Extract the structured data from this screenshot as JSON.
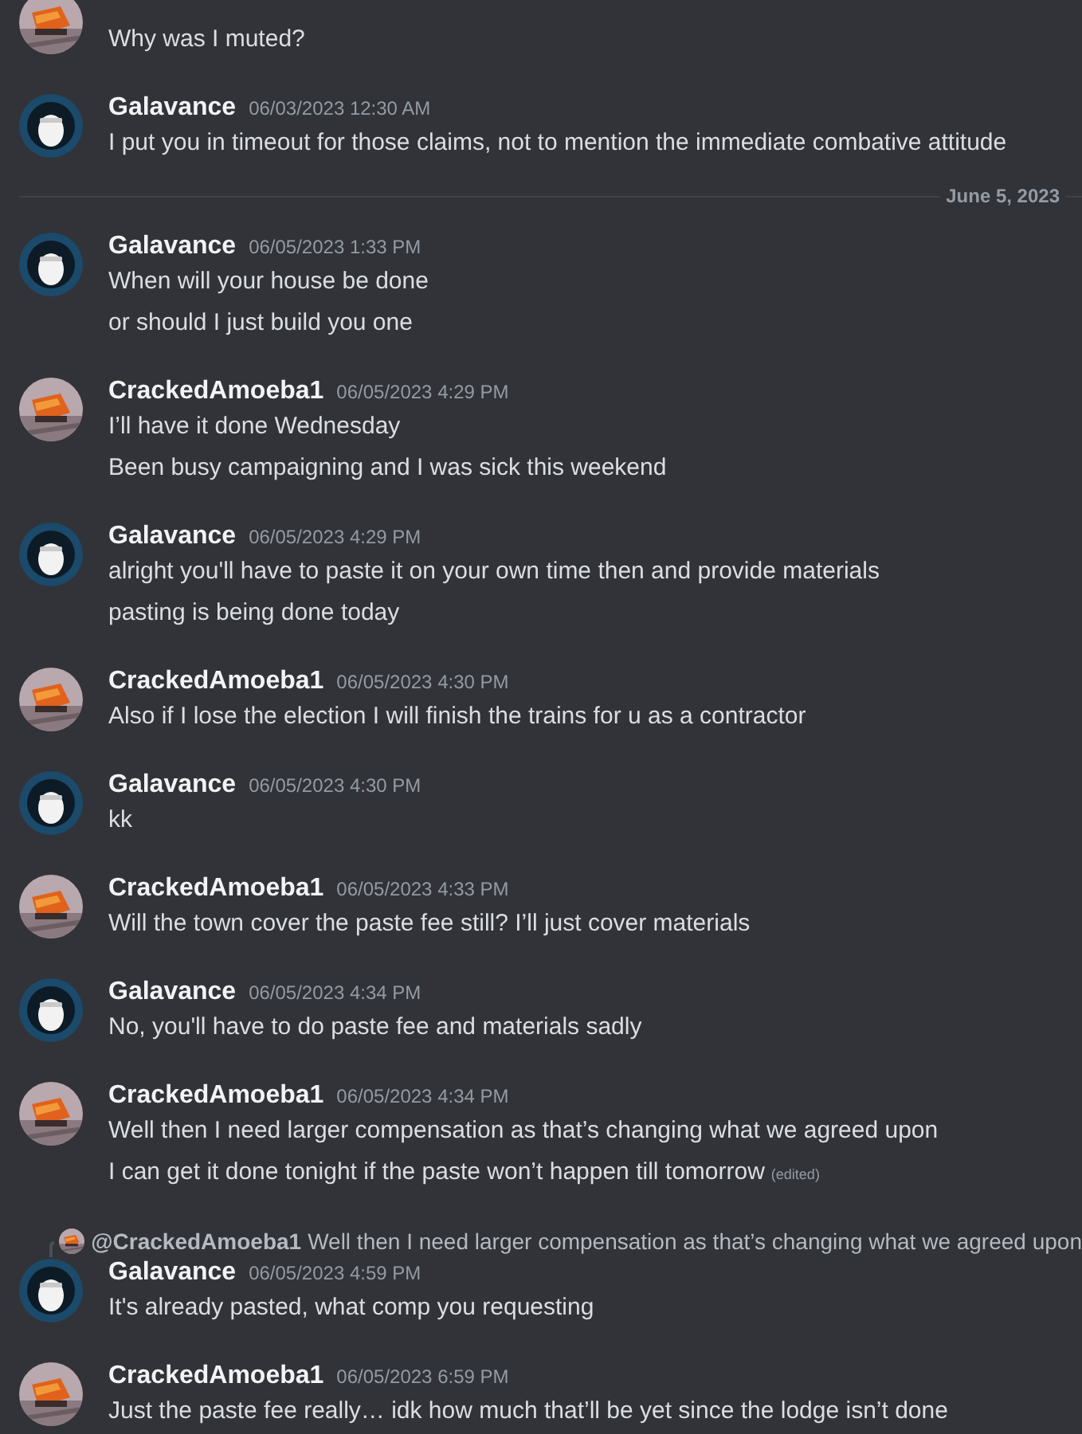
{
  "feed": [
    {
      "kind": "message",
      "avatar": {
        "kind": "train"
      },
      "lines": [
        {
          "text": "Why was I muted?"
        }
      ]
    },
    {
      "kind": "message",
      "author": "Galavance",
      "timestamp": "06/03/2023 12:30 AM",
      "avatar": {
        "kind": "figure"
      },
      "lines": [
        {
          "text": "I put you in timeout for those claims, not to mention the immediate combative attitude"
        }
      ]
    },
    {
      "kind": "divider",
      "label": "June 5, 2023"
    },
    {
      "kind": "message",
      "author": "Galavance",
      "timestamp": "06/05/2023 1:33 PM",
      "avatar": {
        "kind": "figure"
      },
      "lines": [
        {
          "text": "When will your house be done"
        },
        {
          "text": "or should I just build you one"
        }
      ]
    },
    {
      "kind": "message",
      "author": "CrackedAmoeba1",
      "timestamp": "06/05/2023 4:29 PM",
      "avatar": {
        "kind": "train"
      },
      "lines": [
        {
          "text": "I’ll have it done Wednesday"
        },
        {
          "text": "Been busy campaigning and I was sick this weekend"
        }
      ]
    },
    {
      "kind": "message",
      "author": "Galavance",
      "timestamp": "06/05/2023 4:29 PM",
      "avatar": {
        "kind": "figure"
      },
      "lines": [
        {
          "text": "alright you'll have to paste it on your own time then and provide materials"
        },
        {
          "text": "pasting is being done today"
        }
      ]
    },
    {
      "kind": "message",
      "author": "CrackedAmoeba1",
      "timestamp": "06/05/2023 4:30 PM",
      "avatar": {
        "kind": "train"
      },
      "lines": [
        {
          "text": "Also if I lose the election I will finish the trains for u as a contractor"
        }
      ]
    },
    {
      "kind": "message",
      "author": "Galavance",
      "timestamp": "06/05/2023 4:30 PM",
      "avatar": {
        "kind": "figure"
      },
      "lines": [
        {
          "text": "kk"
        }
      ]
    },
    {
      "kind": "message",
      "author": "CrackedAmoeba1",
      "timestamp": "06/05/2023 4:33 PM",
      "avatar": {
        "kind": "train"
      },
      "lines": [
        {
          "text": "Will the town cover the paste fee still? I’ll just cover materials"
        }
      ]
    },
    {
      "kind": "message",
      "author": "Galavance",
      "timestamp": "06/05/2023 4:34 PM",
      "avatar": {
        "kind": "figure"
      },
      "lines": [
        {
          "text": "No, you'll have to do paste fee and materials sadly"
        }
      ]
    },
    {
      "kind": "message",
      "author": "CrackedAmoeba1",
      "timestamp": "06/05/2023 4:34 PM",
      "avatar": {
        "kind": "train"
      },
      "lines": [
        {
          "text": "Well then I need larger compensation as that’s changing what we agreed upon"
        },
        {
          "text": "I can get it done tonight if the paste won’t happen till tomorrow",
          "edited": "(edited)"
        }
      ]
    },
    {
      "kind": "message",
      "author": "Galavance",
      "timestamp": "06/05/2023 4:59 PM",
      "avatar": {
        "kind": "figure"
      },
      "reply": {
        "author": "@CrackedAmoeba1",
        "avatar": {
          "kind": "train"
        },
        "text": "Well then I need larger compensation as that’s changing what we agreed upon"
      },
      "lines": [
        {
          "text": "It's already pasted, what comp you requesting"
        }
      ]
    },
    {
      "kind": "message",
      "author": "CrackedAmoeba1",
      "timestamp": "06/05/2023 6:59 PM",
      "avatar": {
        "kind": "train"
      },
      "lines": [
        {
          "text": "Just the paste fee really… idk how much that’ll be yet since the lodge isn’t done"
        }
      ]
    }
  ]
}
